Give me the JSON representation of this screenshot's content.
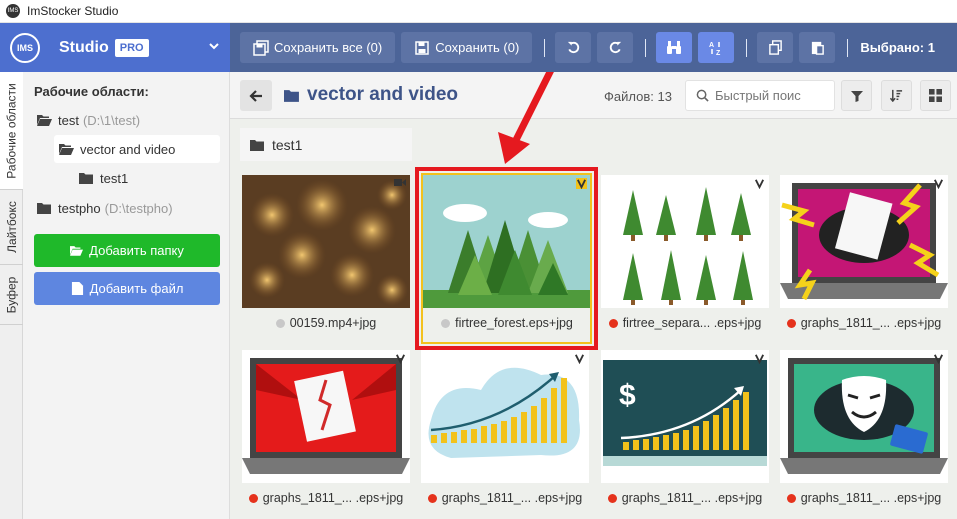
{
  "window": {
    "title": "ImStocker Studio",
    "icon_text": "IMS"
  },
  "left_header": {
    "logo": "IMS",
    "studio": "Studio",
    "badge": "PRO"
  },
  "toolbar": {
    "save_all": "Сохранить все (0)",
    "save": "Сохранить (0)",
    "selected": "Выбрано: 1"
  },
  "vertical_tabs": [
    "Рабочие области",
    "Лайтбокс",
    "Буфер"
  ],
  "sidebar": {
    "title": "Рабочие области:",
    "tree": [
      {
        "label": "test",
        "path": "(D:\\1\\test)"
      },
      {
        "label": "vector and video",
        "path": ""
      },
      {
        "label": "test1",
        "path": ""
      },
      {
        "label": "testpho",
        "path": "(D:\\testpho)"
      }
    ],
    "add_folder": "Добавить папку",
    "add_file": "Добавить файл"
  },
  "main": {
    "folder_title": "vector and video",
    "files_label": "Файлов: 13",
    "search_placeholder": "Быстрый поис",
    "subfolder": "test1"
  },
  "thumbnails": [
    {
      "caption": "00159.mp4+jpg",
      "status": "gray",
      "kind": "video"
    },
    {
      "caption": "firtree_forest.eps+jpg",
      "status": "gray",
      "kind": "vector",
      "selected": true
    },
    {
      "caption": "firtree_separa... .eps+jpg",
      "status": "red",
      "kind": "vector"
    },
    {
      "caption": "graphs_1811_... .eps+jpg",
      "status": "red",
      "kind": "vector"
    },
    {
      "caption": "graphs_1811_... .eps+jpg",
      "status": "red",
      "kind": "vector"
    },
    {
      "caption": "graphs_1811_... .eps+jpg",
      "status": "red",
      "kind": "vector"
    },
    {
      "caption": "graphs_1811_... .eps+jpg",
      "status": "red",
      "kind": "vector"
    },
    {
      "caption": "graphs_1811_... .eps+jpg",
      "status": "red",
      "kind": "vector"
    }
  ],
  "colors": {
    "header_left": "#4d6fcf",
    "toolbar": "#4c6498",
    "add_folder": "#1fb92a",
    "add_file": "#5e86e0",
    "status_red": "#e5321c",
    "status_gray": "#c8c8c8",
    "highlight": "#e5191f"
  }
}
